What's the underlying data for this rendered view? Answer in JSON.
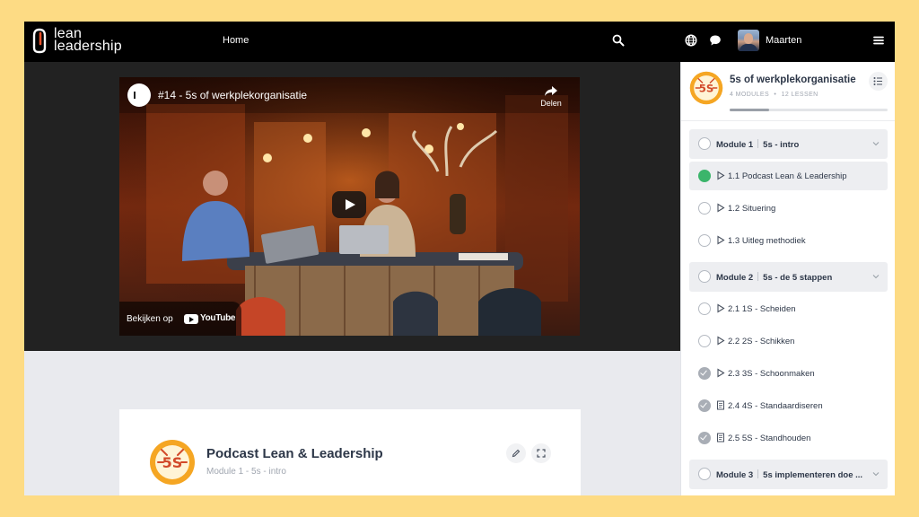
{
  "header": {
    "logo_line1": "lean",
    "logo_line2": "leadership",
    "nav_home": "Home",
    "search_icon": "search-icon",
    "globe_icon": "globe-icon",
    "chat_icon": "chat-icon",
    "user_name": "Maarten",
    "menu_icon": "hamburger-menu-icon"
  },
  "video": {
    "title": "#14 - 5s of werkplekorganisatie",
    "share_label": "Delen",
    "watch_on": "Bekijken op",
    "youtube": "YouTube",
    "play_icon": "play-icon"
  },
  "lesson": {
    "badge": "5S",
    "title": "Podcast Lean & Leadership",
    "subtitle": "Module 1 - 5s - intro",
    "edit_icon": "pencil-icon",
    "expand_icon": "fullscreen-icon"
  },
  "course": {
    "badge": "5S",
    "title": "5s of werkplekorganisatie",
    "modules_count": "4 MODULES",
    "lessons_count": "12 LESSEN",
    "meta_sep": "•",
    "progress": 0.25,
    "modules": [
      {
        "label": "Module 1",
        "name": "5s - intro",
        "lessons": [
          {
            "label": "1.1 Podcast Lean & Leadership",
            "type": "video",
            "status": "current"
          },
          {
            "label": "1.2 Situering",
            "type": "video",
            "status": "open"
          },
          {
            "label": "1.3 Uitleg methodiek",
            "type": "video",
            "status": "open"
          }
        ]
      },
      {
        "label": "Module 2",
        "name": "5s - de 5 stappen",
        "lessons": [
          {
            "label": "2.1 1S - Scheiden",
            "type": "video",
            "status": "open"
          },
          {
            "label": "2.2 2S - Schikken",
            "type": "video",
            "status": "open"
          },
          {
            "label": "2.3 3S - Schoonmaken",
            "type": "video",
            "status": "done"
          },
          {
            "label": "2.4 4S - Standaardiseren",
            "type": "document",
            "status": "done"
          },
          {
            "label": "2.5 5S - Standhouden",
            "type": "document",
            "status": "done"
          }
        ]
      },
      {
        "label": "Module 3",
        "name": "5s implementeren doe ...",
        "lessons": []
      }
    ]
  },
  "colors": {
    "frame": "#FDDB84",
    "topbar": "#000000",
    "accent_green": "#3BB56B",
    "badge_orange": "#F5A623"
  }
}
